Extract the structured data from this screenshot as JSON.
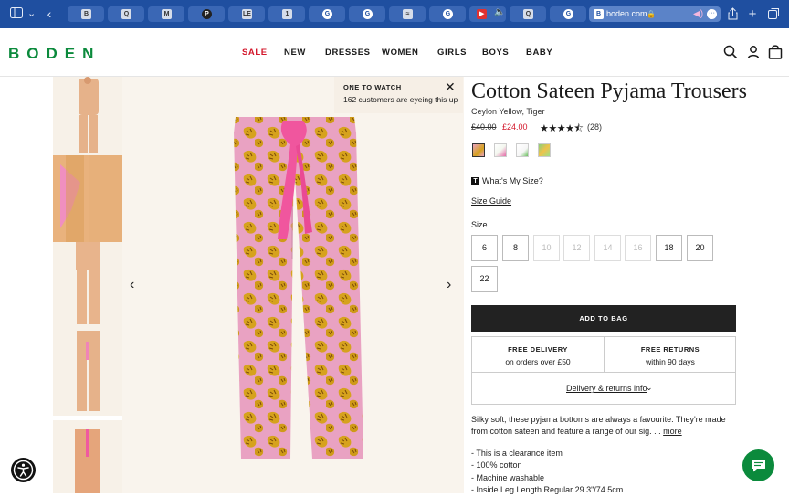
{
  "browser": {
    "tabs": [
      {
        "icon": "boden-favicon",
        "glyph": "B"
      },
      {
        "icon": "tab-favicon",
        "glyph": "Q"
      },
      {
        "icon": "tab-favicon",
        "glyph": "M"
      },
      {
        "icon": "pinterest-favicon",
        "glyph": "P"
      },
      {
        "icon": "tab-favicon",
        "glyph": "LE"
      },
      {
        "icon": "tab-favicon",
        "glyph": "1"
      },
      {
        "icon": "google-favicon",
        "glyph": "G"
      },
      {
        "icon": "google-favicon",
        "glyph": "G"
      },
      {
        "icon": "tab-favicon",
        "glyph": "≈"
      },
      {
        "icon": "google-favicon",
        "glyph": "G"
      },
      {
        "icon": "youtube-favicon",
        "glyph": "▶"
      },
      {
        "icon": "tab-favicon",
        "glyph": "Q"
      },
      {
        "icon": "google-favicon",
        "glyph": "G"
      }
    ],
    "address": "boden.com"
  },
  "header": {
    "logo": "BODEN",
    "nav": [
      "SALE",
      "NEW",
      "DRESSES",
      "WOMEN",
      "GIRLS",
      "BOYS",
      "BABY"
    ]
  },
  "watch": {
    "title": "ONE TO WATCH",
    "subtitle": "162 customers are eyeing this up"
  },
  "product": {
    "title": "Cotton Sateen Pyjama Trousers",
    "color": "Ceylon Yellow, Tiger",
    "price_old": "£40.00",
    "price_new": "£24.00",
    "rating": 4.5,
    "stars": "★★★★⯪",
    "reviews": "(28)",
    "whats_my_size": "What's My Size?",
    "size_guide": "Size Guide",
    "size_label": "Size",
    "sizes": [
      {
        "label": "6",
        "available": true
      },
      {
        "label": "8",
        "available": true
      },
      {
        "label": "10",
        "available": false
      },
      {
        "label": "12",
        "available": false
      },
      {
        "label": "14",
        "available": false
      },
      {
        "label": "16",
        "available": false
      },
      {
        "label": "18",
        "available": true
      },
      {
        "label": "20",
        "available": true
      },
      {
        "label": "22",
        "available": true
      }
    ],
    "add_to_bag": "ADD TO BAG",
    "delivery": {
      "free_delivery_title": "FREE DELIVERY",
      "free_delivery_sub": "on orders over £50",
      "free_returns_title": "FREE RETURNS",
      "free_returns_sub": "within 90 days",
      "info_link": "Delivery & returns info"
    },
    "description": "Silky soft, these pyjama bottoms are always a favourite. They're made from cotton sateen and feature a range of our sig. . .",
    "more": "more",
    "bullets": [
      "- This is a clearance item",
      "- 100% cotton",
      "- Machine washable",
      "- Inside Leg Length Regular 29.3\"/74.5cm"
    ]
  },
  "colors": {
    "brand_green": "#0b8a3c",
    "sale_red": "#d3172b",
    "pink": "#e8a6c4",
    "tiger_yellow": "#d7a31c"
  }
}
